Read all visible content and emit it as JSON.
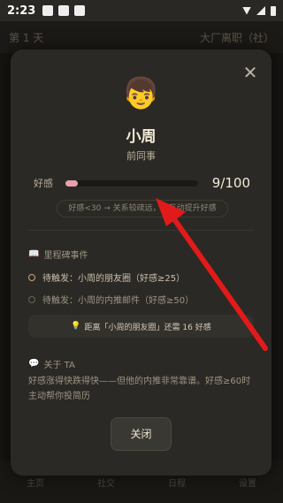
{
  "status_bar": {
    "time": "2:23"
  },
  "background": {
    "day_text": "第 1 天",
    "right_text": "大厂离职（社）",
    "nav": [
      "主页",
      "社交",
      "日程",
      "设置"
    ]
  },
  "modal": {
    "avatar_emoji": "👦",
    "name": "小周",
    "role": "前同事",
    "favor": {
      "label": "好感",
      "value_text": "9/100",
      "fraction": 0.09,
      "hint": "好感<30 → 关系较疏远，多互动提升好感"
    },
    "milestones": {
      "title": "里程碑事件",
      "items": [
        {
          "text": "待触发：小周的朋友圈（好感≥25）",
          "active": true
        },
        {
          "text": "待触发：小周的内推邮件（好感≥50）",
          "active": false
        }
      ],
      "next_tip": "距离「小周的朋友圈」还需 16 好感"
    },
    "about": {
      "title": "关于 TA",
      "text": "好感涨得快跌得快——但他的内推非常靠谱。好感≥60时主动帮你投简历"
    },
    "close_label": "关闭"
  },
  "colors": {
    "accent": "#e31a1a",
    "favor_fill": "#e9a0ae"
  }
}
